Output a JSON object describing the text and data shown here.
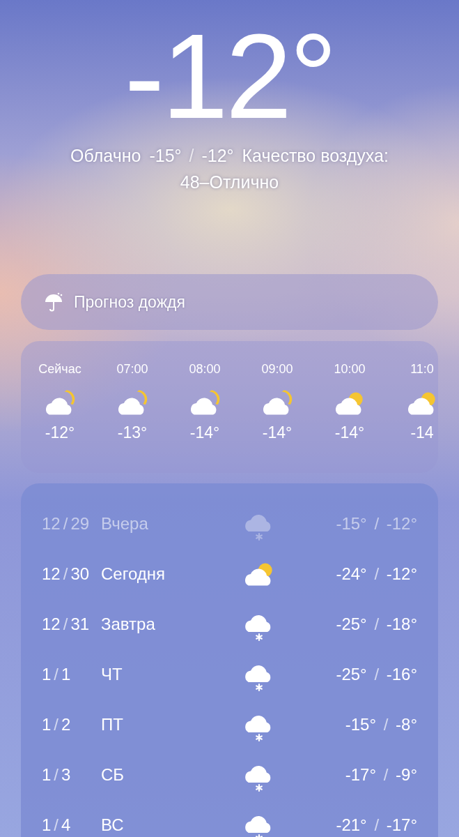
{
  "current": {
    "temperature": "-12°",
    "condition": "Облачно",
    "range": "-15° / -12°",
    "air_quality_label": "Качество воздуха:",
    "air_quality": "48–Отлично"
  },
  "rain_forecast": {
    "label": "Прогноз дождя"
  },
  "hourly": [
    {
      "time": "Сейчас",
      "kind": "cloud-moon",
      "temp": "-12°"
    },
    {
      "time": "07:00",
      "kind": "cloud-moon",
      "temp": "-13°"
    },
    {
      "time": "08:00",
      "kind": "cloud-moon",
      "temp": "-14°"
    },
    {
      "time": "09:00",
      "kind": "cloud-moon",
      "temp": "-14°"
    },
    {
      "time": "10:00",
      "kind": "cloud-sun",
      "temp": "-14°"
    },
    {
      "time": "11:0",
      "kind": "cloud-sun",
      "temp": "-14"
    }
  ],
  "daily": [
    {
      "date": "12/29",
      "day": "Вчера",
      "kind": "snow",
      "range": "-15° / -12°",
      "past": true
    },
    {
      "date": "12/30",
      "day": "Сегодня",
      "kind": "cloud-sun",
      "range": "-24° / -12°",
      "past": false
    },
    {
      "date": "12/31",
      "day": "Завтра",
      "kind": "snow",
      "range": "-25° / -18°",
      "past": false
    },
    {
      "date": "1/1",
      "day": "ЧТ",
      "kind": "snow",
      "range": "-25° / -16°",
      "past": false
    },
    {
      "date": "1/2",
      "day": "ПТ",
      "kind": "snow",
      "range": "-15° / -8°",
      "past": false
    },
    {
      "date": "1/3",
      "day": "СБ",
      "kind": "snow",
      "range": "-17° / -9°",
      "past": false
    },
    {
      "date": "1/4",
      "day": "ВС",
      "kind": "snow",
      "range": "-21° / -17°",
      "past": false
    }
  ]
}
